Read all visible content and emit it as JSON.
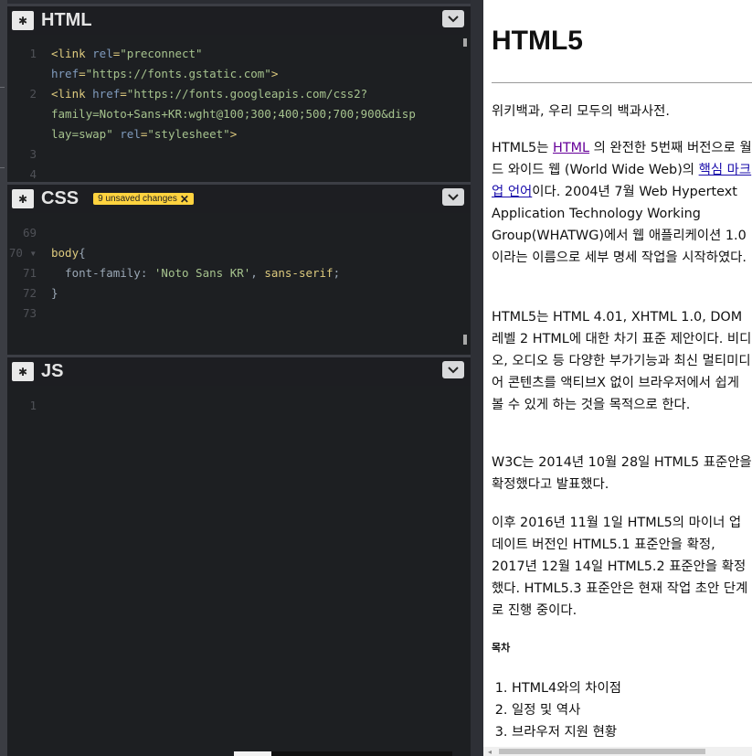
{
  "panes": {
    "html": {
      "title": "HTML",
      "lines": [
        {
          "n": "1",
          "parts": [
            [
              "tag",
              "<link "
            ],
            [
              "attr",
              "rel"
            ],
            [
              "tag",
              "="
            ],
            [
              "str",
              "\"preconnect\""
            ]
          ]
        },
        {
          "n": "",
          "parts": [
            [
              "attr",
              "href"
            ],
            [
              "tag",
              "="
            ],
            [
              "str",
              "\"https://fonts.gstatic.com\""
            ],
            [
              "tag",
              ">"
            ]
          ]
        },
        {
          "n": "2",
          "parts": [
            [
              "tag",
              "<link "
            ],
            [
              "attr",
              "href"
            ],
            [
              "tag",
              "="
            ],
            [
              "str",
              "\"https://fonts.googleapis.com/css2?"
            ]
          ]
        },
        {
          "n": "",
          "parts": [
            [
              "str",
              "family=Noto+Sans+KR:wght@100;300;400;500;700;900&disp"
            ]
          ]
        },
        {
          "n": "",
          "parts": [
            [
              "str",
              "lay=swap\""
            ],
            [
              "tag",
              " "
            ],
            [
              "attr",
              "rel"
            ],
            [
              "tag",
              "="
            ],
            [
              "str",
              "\"stylesheet\""
            ],
            [
              "tag",
              ">"
            ]
          ]
        },
        {
          "n": "3",
          "parts": []
        },
        {
          "n": "4",
          "parts": []
        }
      ]
    },
    "css": {
      "title": "CSS",
      "badge": "9 unsaved changes",
      "badge_close": "✕",
      "lines": [
        {
          "n": "69",
          "parts": []
        },
        {
          "n": "70 ▾",
          "parts": [
            [
              "tag",
              "body"
            ],
            [
              "prop",
              "{"
            ]
          ]
        },
        {
          "n": "71",
          "parts": [
            [
              "prop",
              "  font-family"
            ],
            [
              "prop",
              ": "
            ],
            [
              "str",
              "'Noto Sans KR'"
            ],
            [
              "prop",
              ", "
            ],
            [
              "tag",
              "sans-serif"
            ],
            [
              "prop",
              ";"
            ]
          ]
        },
        {
          "n": "72",
          "parts": [
            [
              "prop",
              "}"
            ]
          ]
        },
        {
          "n": "73",
          "parts": []
        }
      ]
    },
    "js": {
      "title": "JS",
      "lines": [
        {
          "n": "1",
          "parts": []
        }
      ]
    }
  },
  "preview": {
    "title": "HTML5",
    "tagline": "위키백과, 우리 모두의 백과사전.",
    "p1": {
      "pre": "HTML5는 ",
      "link1": "HTML",
      "mid": " 의 완전한 5번째 버전으로 월드 와이드 웹 (World Wide Web)의 ",
      "link2": "핵심 마크업 언어",
      "post": "이다. 2004년 7월 Web Hypertext Application Technology Working Group(WHATWG)에서 웹 애플리케이션 1.0이라는 이름으로 세부 명세 작업을 시작하였다."
    },
    "p2": "HTML5는 HTML 4.01, XHTML 1.0, DOM 레벨 2 HTML에 대한 차기 표준 제안이다. 비디오, 오디오 등 다양한 부가기능과 최신 멀티미디어 콘텐츠를 액티브X 없이 브라우저에서 쉽게 볼 수 있게 하는 것을 목적으로 한다.",
    "p3": "W3C는 2014년 10월 28일 HTML5 표준안을 확정했다고 발표했다.",
    "p4": "이후 2016년 11월 1일 HTML5의 마이너 업데이트 버전인 HTML5.1 표준안을 확정, 2017년 12월 14일 HTML5.2 표준안을 확정했다. HTML5.3 표준안은 현재 작업 초안 단계로 진행 중이다.",
    "toc_heading": "목차",
    "toc": [
      "HTML4와의 차이점",
      "일정 및 역사",
      "브라우저 지원 현황"
    ]
  },
  "icons": {
    "gear": "gear-icon",
    "collapse": "chevron-down-icon"
  }
}
